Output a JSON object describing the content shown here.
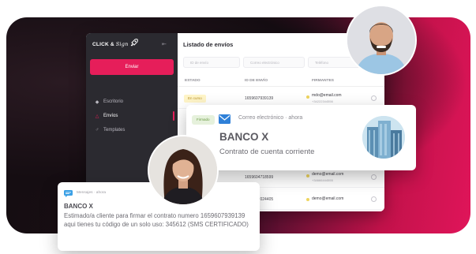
{
  "app": {
    "logo_text": "CLICK &",
    "logo_script": "Sign",
    "send_label": "Enviar",
    "nav": [
      {
        "label": "Escritorio",
        "icon": "desktop-icon"
      },
      {
        "label": "Envíos",
        "icon": "send-icon",
        "active": true
      },
      {
        "label": "Templates",
        "icon": "user-icon"
      }
    ],
    "main_title": "Listado de envíos",
    "filters": [
      "ID de envío",
      "Correo electrónico",
      "Teléfono"
    ],
    "columns": [
      "ESTADO",
      "ID DE ENVÍO",
      "FIRMANTES"
    ],
    "rows": [
      {
        "status": "En curso",
        "id": "1659607939139",
        "email": "mdo@email.com",
        "phone": "+34222344556"
      },
      {
        "status": "",
        "id": "1659604718599",
        "email": "demo@email.com",
        "phone": "+34666444555"
      },
      {
        "status": "",
        "id": "1659337024405",
        "email": "demo@email.com",
        "phone": ""
      }
    ]
  },
  "email_notification": {
    "badge": "Firmado",
    "meta": "Correo electrónico · ahora",
    "bank": "BANCO X",
    "description": "Contrato de cuenta corriente"
  },
  "sms_notification": {
    "meta": "Mensajes · ahora",
    "bank": "BANCO X",
    "text": "Estimado/a cliente para firmar el contrato numero 1659607939139 aqui tienes tu código de un solo uso: 345612 (SMS CERTIFICADO)"
  },
  "colors": {
    "accent": "#e61e5a",
    "sidebar": "#2b2a30",
    "signed_badge": "#e6f1dc",
    "in_progress_badge": "#fff5c8"
  }
}
